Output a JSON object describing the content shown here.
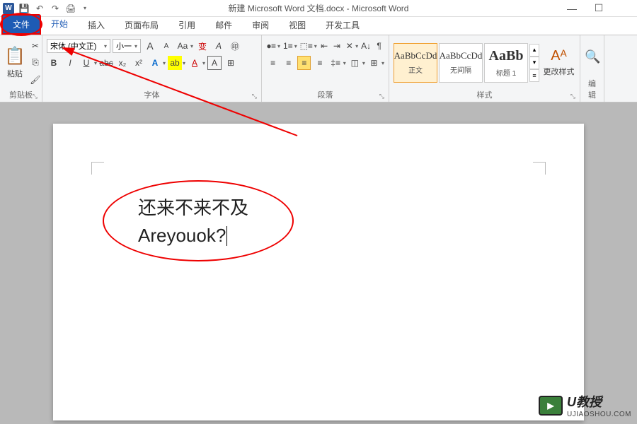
{
  "title": "新建 Microsoft Word 文档.docx - Microsoft Word",
  "tabs": {
    "file": "文件",
    "home": "开始",
    "insert": "插入",
    "layout": "页面布局",
    "references": "引用",
    "mail": "邮件",
    "review": "审阅",
    "view": "视图",
    "developer": "开发工具"
  },
  "clipboard": {
    "paste": "粘贴",
    "label": "剪贴板"
  },
  "font": {
    "name": "宋体 (中文正)",
    "size": "小一",
    "grow": "A",
    "shrink": "A",
    "case": "Aa",
    "clear": "Aª",
    "bold": "B",
    "italic": "I",
    "underline": "U",
    "strike": "abc",
    "sub": "x₂",
    "sup": "x²",
    "effects": "A",
    "highlight": "A",
    "color": "A",
    "phonetic": "拼",
    "border": "A",
    "label": "字体"
  },
  "para": {
    "label": "段落"
  },
  "styles": {
    "s1": {
      "preview": "AaBbCcDd",
      "name": "正文"
    },
    "s2": {
      "preview": "AaBbCcDd",
      "name": "无间隔"
    },
    "s3": {
      "preview": "AaBb",
      "name": "标题 1"
    },
    "change": "更改样式",
    "label": "样式"
  },
  "editing": {
    "label": "编辑"
  },
  "document": {
    "line1": "还来不来不及",
    "line2": "Areyouok?"
  },
  "watermark": {
    "brand": "U教授",
    "url": "UJIAOSHOU.COM"
  }
}
